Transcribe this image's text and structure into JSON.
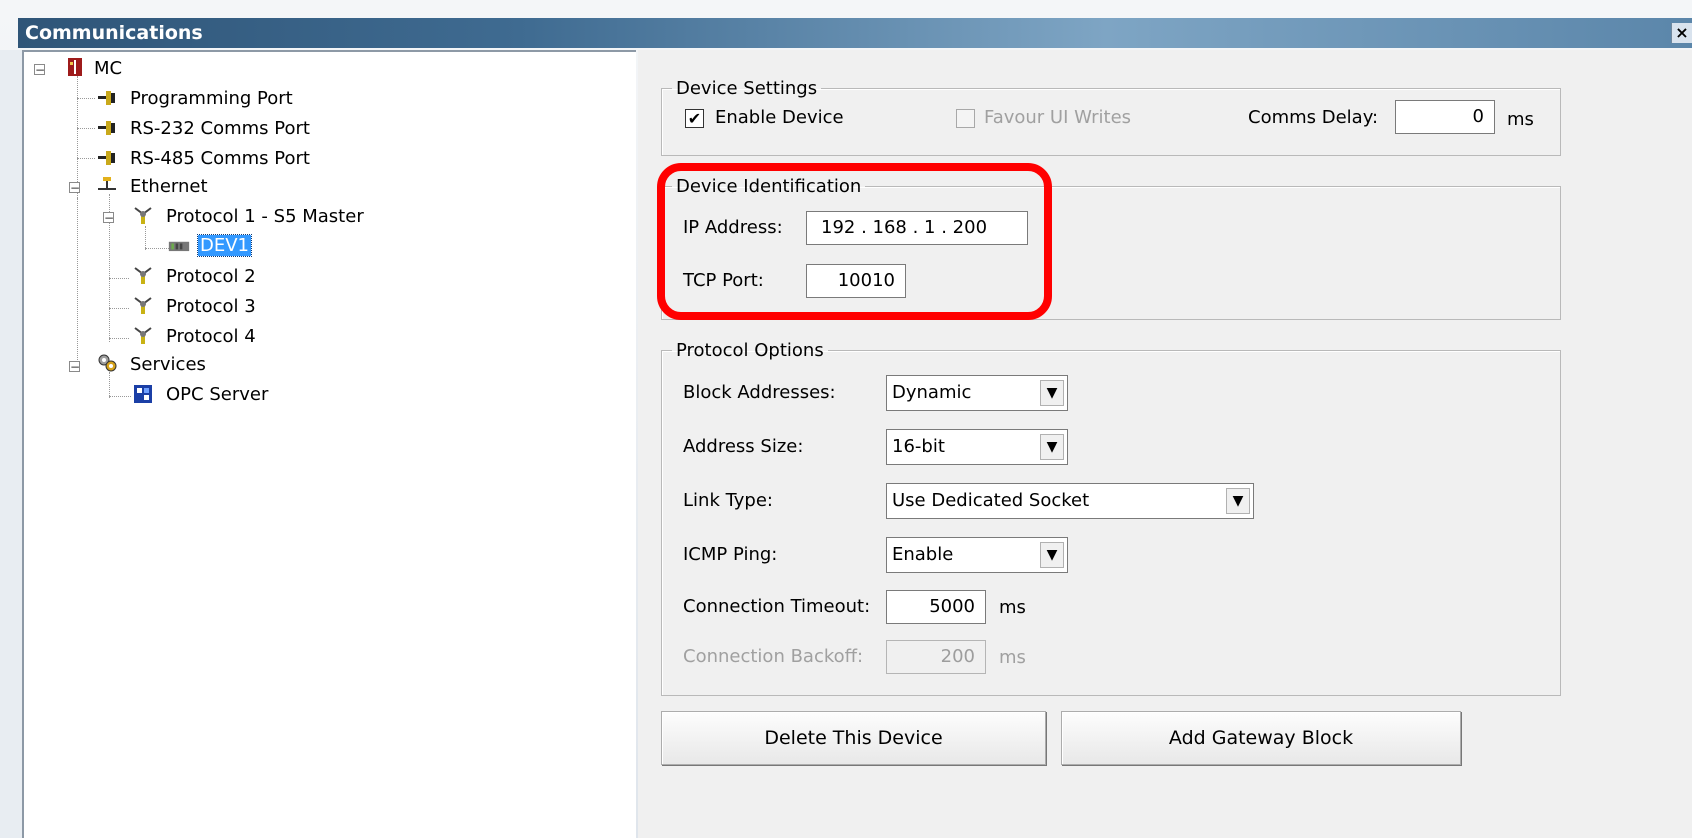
{
  "window": {
    "title": "Communications",
    "close_glyph": "×"
  },
  "tree": {
    "nodes": [
      {
        "label": "MC",
        "icon": "processor-icon"
      },
      {
        "label": "Programming Port",
        "icon": "port-icon"
      },
      {
        "label": "RS-232 Comms Port",
        "icon": "port-icon"
      },
      {
        "label": "RS-485 Comms Port",
        "icon": "port-icon"
      },
      {
        "label": "Ethernet",
        "icon": "network-icon"
      },
      {
        "label": "Protocol 1 - S5 Master",
        "icon": "protocol-icon"
      },
      {
        "label": "DEV1",
        "icon": "device-icon",
        "selected": true
      },
      {
        "label": "Protocol 2",
        "icon": "protocol-icon"
      },
      {
        "label": "Protocol 3",
        "icon": "protocol-icon"
      },
      {
        "label": "Protocol 4",
        "icon": "protocol-icon"
      },
      {
        "label": "Services",
        "icon": "gear-icon"
      },
      {
        "label": "OPC Server",
        "icon": "server-icon"
      }
    ]
  },
  "device_settings": {
    "legend": "Device Settings",
    "enable_device_label": "Enable Device",
    "enable_device_checked": "✔",
    "favour_ui_writes_label": "Favour UI Writes",
    "comms_delay_label": "Comms Delay:",
    "comms_delay_value": "0",
    "comms_delay_unit": "ms"
  },
  "device_identification": {
    "legend": "Device Identification",
    "ip_label": "IP Address:",
    "ip_value": "192 . 168 .  1   . 200",
    "tcp_label": "TCP Port:",
    "tcp_value": "10010"
  },
  "protocol_options": {
    "legend": "Protocol Options",
    "block_addresses_label": "Block Addresses:",
    "block_addresses_value": "Dynamic",
    "address_size_label": "Address Size:",
    "address_size_value": "16-bit",
    "link_type_label": "Link Type:",
    "link_type_value": "Use Dedicated Socket",
    "icmp_ping_label": "ICMP Ping:",
    "icmp_ping_value": "Enable",
    "connection_timeout_label": "Connection Timeout:",
    "connection_timeout_value": "5000",
    "connection_timeout_unit": "ms",
    "connection_backoff_label": "Connection Backoff:",
    "connection_backoff_value": "200",
    "connection_backoff_unit": "ms"
  },
  "buttons": {
    "delete_device": "Delete This Device",
    "add_gateway_block": "Add Gateway Block"
  },
  "icons": {
    "expand_minus": "−",
    "dropdown_arrow": "▼"
  },
  "colors": {
    "highlight": "#ff0000",
    "selection": "#3399ff"
  }
}
